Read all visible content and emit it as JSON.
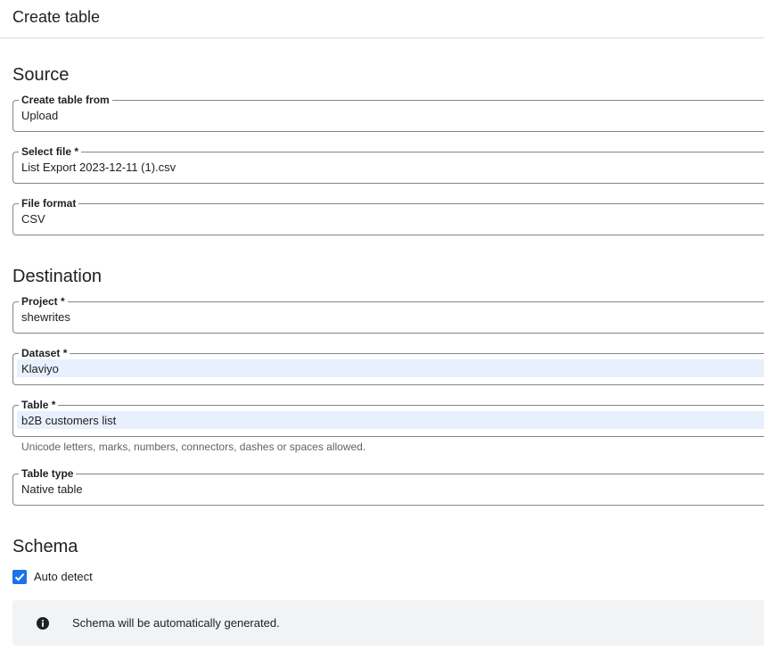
{
  "header": {
    "title": "Create table"
  },
  "source": {
    "title": "Source",
    "create_from": {
      "label": "Create table from",
      "value": "Upload"
    },
    "select_file": {
      "label": "Select file *",
      "value": "List Export 2023-12-11 (1).csv"
    },
    "file_format": {
      "label": "File format",
      "value": "CSV"
    }
  },
  "destination": {
    "title": "Destination",
    "project": {
      "label": "Project *",
      "value": "shewrites"
    },
    "dataset": {
      "label": "Dataset *",
      "value": "Klaviyo"
    },
    "table": {
      "label": "Table *",
      "value": "b2B customers list",
      "hint": "Unicode letters, marks, numbers, connectors, dashes or spaces allowed."
    },
    "table_type": {
      "label": "Table type",
      "value": "Native table"
    }
  },
  "schema": {
    "title": "Schema",
    "auto_detect": {
      "label": "Auto detect",
      "checked": true
    },
    "info": {
      "icon": "info-icon",
      "text": "Schema will be automatically generated."
    }
  },
  "colors": {
    "accent": "#1a73e8",
    "autofill": "#e8f0fe",
    "banner": "#f1f3f4",
    "border": "#80868b"
  }
}
